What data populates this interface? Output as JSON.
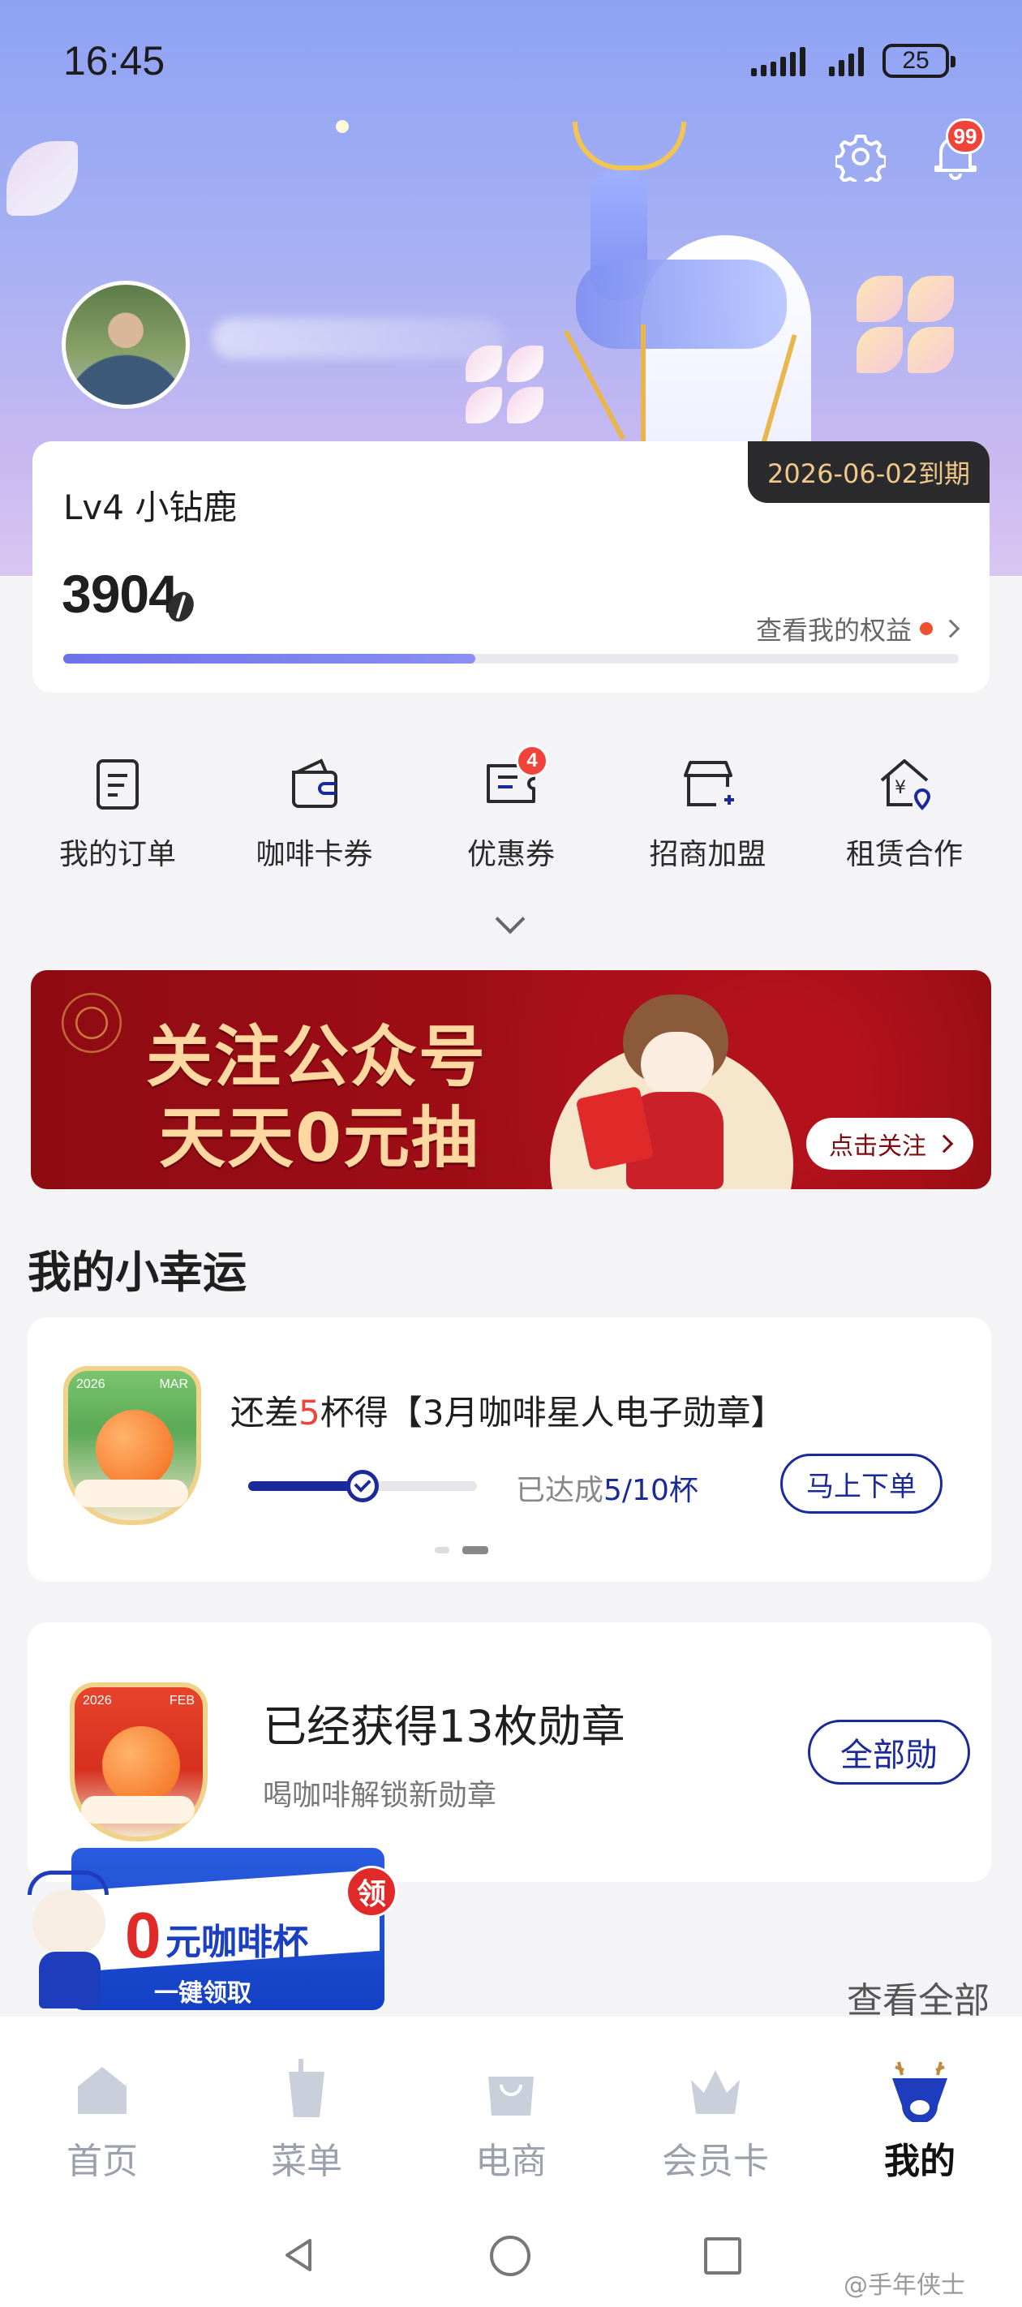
{
  "status_bar": {
    "time": "16:45",
    "battery": "25"
  },
  "header": {
    "notification_count": "99"
  },
  "member": {
    "level": "Lv4 小钻鹿",
    "expire": "2026-06-02到期",
    "points": "3904",
    "benefits_link": "查看我的权益",
    "level_progress": 0.46
  },
  "quick_menu": [
    {
      "label": "我的订单",
      "icon": "order-icon"
    },
    {
      "label": "咖啡卡券",
      "icon": "wallet-icon"
    },
    {
      "label": "优惠券",
      "icon": "coupon-icon",
      "badge": "4"
    },
    {
      "label": "招商加盟",
      "icon": "store-icon"
    },
    {
      "label": "租赁合作",
      "icon": "rental-icon"
    }
  ],
  "banner": {
    "line1": "关注公众号",
    "line2": "天天0元抽",
    "button": "点击关注"
  },
  "luck": {
    "section_title": "我的小幸运",
    "text_before": "还差",
    "text_count": "5",
    "text_after": "杯得【3月咖啡星人电子勋章】",
    "progress_label": "已达成",
    "progress_value": "5/10杯",
    "progress_fraction": 0.5,
    "order_button": "马上下单",
    "badge_year": "2026",
    "badge_month": "MAR"
  },
  "medals": {
    "title": "已经获得13枚勋章",
    "subtitle": "喝咖啡解锁新勋章",
    "button": "全部勋",
    "badge_year": "2026",
    "badge_month": "FEB"
  },
  "float_ad": {
    "zero": "0",
    "title": "元咖啡杯",
    "cta": "一键领取",
    "tag": "领"
  },
  "view_all": "查看全部",
  "tabs": [
    {
      "label": "首页",
      "icon": "home-icon",
      "active": false
    },
    {
      "label": "菜单",
      "icon": "cup-icon",
      "active": false
    },
    {
      "label": "电商",
      "icon": "bag-icon",
      "active": false
    },
    {
      "label": "会员卡",
      "icon": "crown-icon",
      "active": false
    },
    {
      "label": "我的",
      "icon": "deer-icon",
      "active": true
    }
  ],
  "watermark": "@手年侠士"
}
